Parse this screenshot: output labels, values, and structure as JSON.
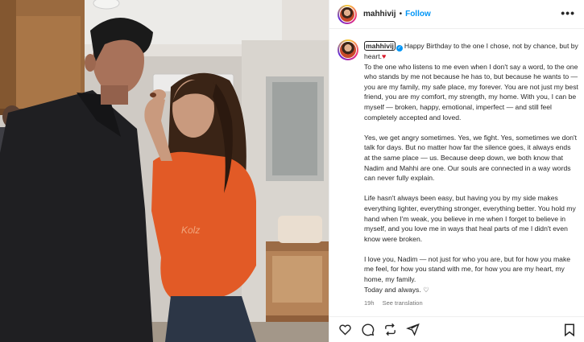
{
  "header": {
    "username": "mahhivij",
    "separator": "•",
    "follow_label": "Follow",
    "more_label": "•••"
  },
  "caption": {
    "username": "mahhivij",
    "verified_mark": "✓",
    "first_line": "Happy Birthday to the one I chose, not by chance, but by heart.",
    "heart_emoji": "♥",
    "paragraph_1": "To the one who listens to me even when I don't say a word, to the one who stands by me not because he has to, but because he wants to — you are my family, my safe place, my forever. You are not just my best friend, you are my comfort, my strength, my home. With you, I can be myself — broken, happy, emotional, imperfect — and still feel completely accepted and loved.",
    "paragraph_2": "Yes, we get angry sometimes. Yes, we fight. Yes, sometimes we don't talk for days. But no matter how far the silence goes, it always ends at the same place — us. Because deep down, we both know that Nadim and Mahhi are one. Our souls are connected in a way words can never fully explain.",
    "paragraph_3": "Life hasn't always been easy, but having you by my side makes everything lighter, everything stronger, everything better. You hold my hand when I'm weak, you believe in me when I forget to believe in myself, and you love me in ways that heal parts of me I didn't even know were broken.",
    "paragraph_4": "I love you, Nadim — not just for who you are, but for how you make me feel, for how you stand with me, for how you are my heart, my home, my family.",
    "closing": "Today and always.",
    "closing_emoji": "♡"
  },
  "meta": {
    "timestamp": "19h",
    "see_translation_label": "See translation"
  },
  "actions": {
    "icons": [
      "heart-icon",
      "comment-icon",
      "share-icon",
      "save-icon"
    ]
  },
  "colors": {
    "accent": "#0095f6",
    "text": "#262626",
    "secondary_text": "#737373",
    "border": "#efefef",
    "heart_emoji": "#d81b2c"
  }
}
